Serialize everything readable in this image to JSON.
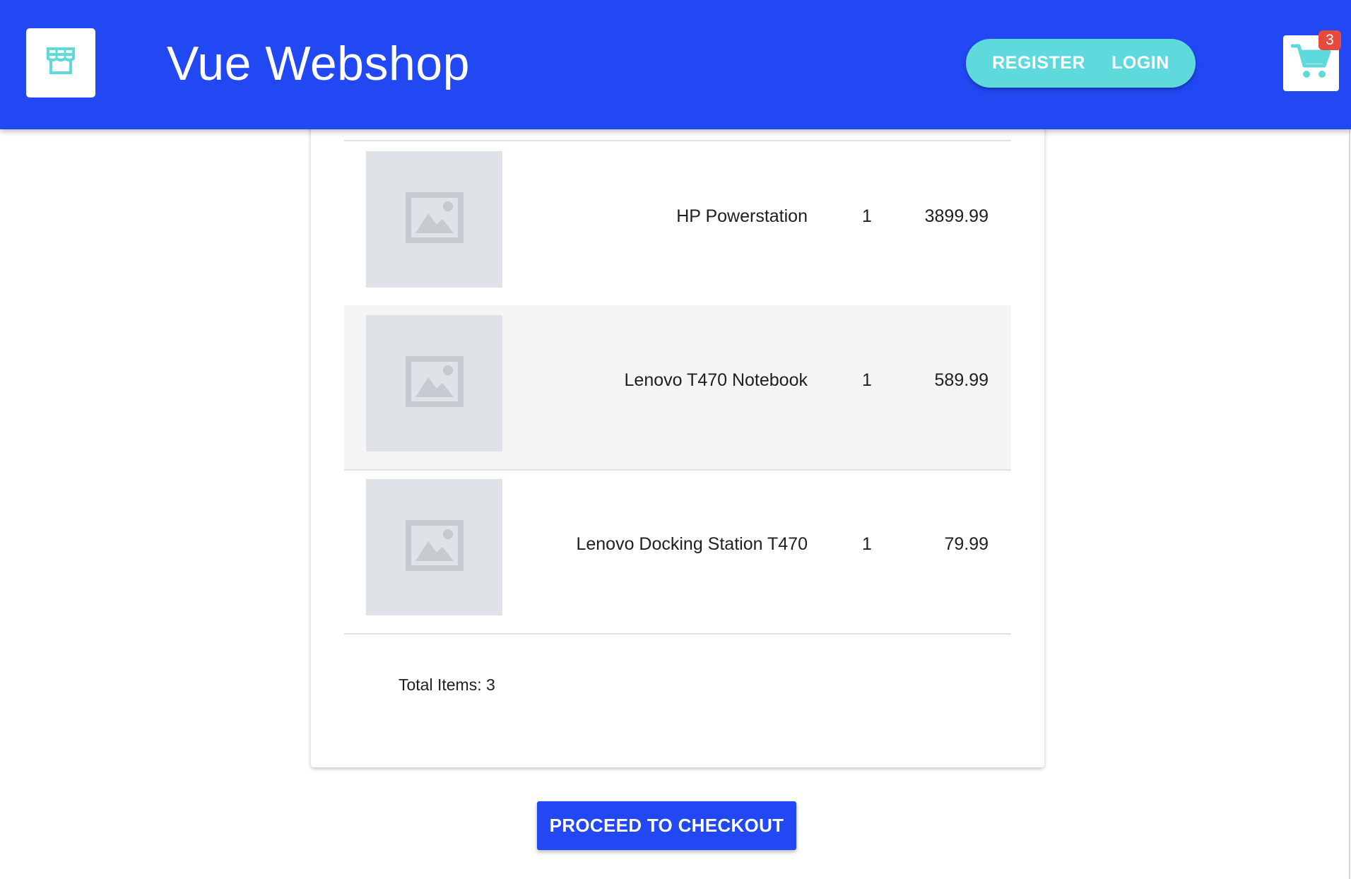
{
  "header": {
    "title": "Vue Webshop",
    "logo_icon": "storefront-icon",
    "register_label": "REGISTER",
    "login_label": "LOGIN",
    "cart_icon": "cart-icon",
    "cart_count": "3"
  },
  "cart": {
    "items": [
      {
        "name": "HP Powerstation",
        "quantity": "1",
        "price": "3899.99",
        "image_icon": "image-placeholder-icon"
      },
      {
        "name": "Lenovo T470 Notebook",
        "quantity": "1",
        "price": "589.99",
        "image_icon": "image-placeholder-icon"
      },
      {
        "name": "Lenovo Docking Station T470",
        "quantity": "1",
        "price": "79.99",
        "image_icon": "image-placeholder-icon"
      }
    ],
    "total_label": "Total Items: 3"
  },
  "checkout": {
    "button_label": "PROCEED TO CHECKOUT"
  },
  "colors": {
    "primary": "#2148f2",
    "accent": "#5fdadc",
    "badge": "#e64a3c"
  }
}
